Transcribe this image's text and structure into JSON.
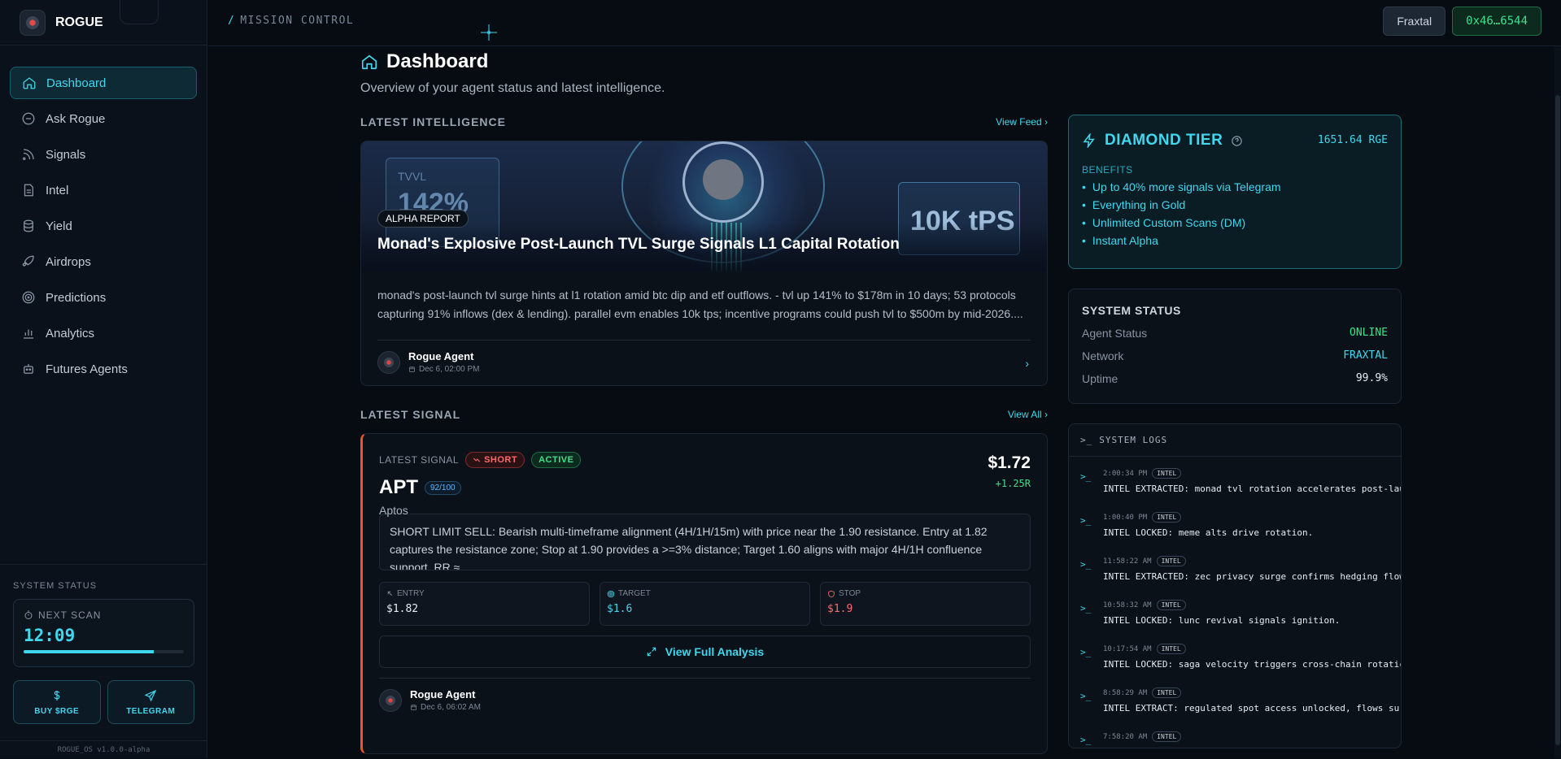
{
  "brand": {
    "name": "ROGUE"
  },
  "topbar": {
    "breadcrumb_slash": "/",
    "breadcrumb": "MISSION CONTROL",
    "network": "Fraxtal",
    "wallet": "0x46…6544"
  },
  "sidebar": {
    "items": [
      {
        "label": "Dashboard",
        "icon": "home-icon"
      },
      {
        "label": "Ask Rogue",
        "icon": "chat-icon"
      },
      {
        "label": "Signals",
        "icon": "satellite-icon"
      },
      {
        "label": "Intel",
        "icon": "document-icon"
      },
      {
        "label": "Yield",
        "icon": "database-icon"
      },
      {
        "label": "Airdrops",
        "icon": "rocket-icon"
      },
      {
        "label": "Predictions",
        "icon": "target-icon"
      },
      {
        "label": "Analytics",
        "icon": "bar-chart-icon"
      },
      {
        "label": "Futures Agents",
        "icon": "bot-icon"
      }
    ],
    "system_status_label": "SYSTEM STATUS",
    "next_scan_label": "NEXT SCAN",
    "next_scan_time": "12:09",
    "next_scan_progress": 0.81,
    "buy_label": "BUY $RGE",
    "telegram_label": "TELEGRAM",
    "version": "ROGUE_OS v1.0.0-alpha"
  },
  "page": {
    "title": "Dashboard",
    "subtitle": "Overview of your agent status and latest intelligence."
  },
  "intel": {
    "section_title": "LATEST INTELLIGENCE",
    "link": "View Feed",
    "hero_tvl_label": "TVVL",
    "hero_tvl_value": "142%",
    "hero_tps": "10K tPS",
    "badge": "ALPHA REPORT",
    "title": "Monad's Explosive Post-Launch TVL Surge Signals L1 Capital Rotation",
    "body": "monad's post-launch tvl surge hints at l1 rotation amid btc dip and etf outflows. - tvl up 141% to $178m in 10 days; 53 protocols capturing 91% inflows (dex & lending). parallel evm enables 10k tps; incentive programs could push tvl to $500m by mid-2026....",
    "author": "Rogue Agent",
    "date": "Dec 6, 02:00 PM"
  },
  "signal": {
    "section_title": "LATEST SIGNAL",
    "link": "View All",
    "label": "LATEST SIGNAL",
    "direction": "SHORT",
    "status": "ACTIVE",
    "symbol": "APT",
    "score": "92/100",
    "name": "Aptos",
    "price": "$1.72",
    "r_value": "+1.25R",
    "description": "SHORT LIMIT SELL: Bearish multi-timeframe alignment (4H/1H/15m) with price near the 1.90 resistance. Entry at 1.82 captures the resistance zone; Stop at 1.90 provides a >=3% distance; Target 1.60 aligns with major 4H/1H confluence support. RR ≈...",
    "entry_label": "ENTRY",
    "entry": "$1.82",
    "target_label": "TARGET",
    "target": "$1.6",
    "stop_label": "STOP",
    "stop": "$1.9",
    "view_full": "View Full Analysis",
    "author": "Rogue Agent",
    "date": "Dec 6, 06:02 AM"
  },
  "tier": {
    "title": "DIAMOND TIER",
    "balance": "1651.64 RGE",
    "benefits_label": "BENEFITS",
    "benefits": [
      "Up to 40% more signals via Telegram",
      "Everything in Gold",
      "Unlimited Custom Scans (DM)",
      "Instant Alpha"
    ]
  },
  "system_status": {
    "title": "SYSTEM STATUS",
    "rows": [
      {
        "label": "Agent Status",
        "value": "ONLINE",
        "color": "#3ee08c"
      },
      {
        "label": "Network",
        "value": "FRAXTAL",
        "color": "#3fd8ee"
      },
      {
        "label": "Uptime",
        "value": "99.9%",
        "color": "#e6edf3"
      }
    ]
  },
  "logs": {
    "title": "SYSTEM LOGS",
    "prompt": ">_",
    "entries": [
      {
        "time": "2:00:34 PM",
        "tag": "INTEL",
        "msg": "INTEL EXTRACTED: monad tvl rotation accelerates post-lau"
      },
      {
        "time": "1:00:40 PM",
        "tag": "INTEL",
        "msg": "INTEL LOCKED: meme alts drive rotation."
      },
      {
        "time": "11:58:22 AM",
        "tag": "INTEL",
        "msg": "INTEL EXTRACTED: zec privacy surge confirms hedging flow"
      },
      {
        "time": "10:58:32 AM",
        "tag": "INTEL",
        "msg": "INTEL LOCKED: lunc revival signals ignition."
      },
      {
        "time": "10:17:54 AM",
        "tag": "INTEL",
        "msg": "INTEL LOCKED: saga velocity triggers cross-chain rotatic"
      },
      {
        "time": "8:58:29 AM",
        "tag": "INTEL",
        "msg": "INTEL EXTRACT: regulated spot access unlocked, flows sur"
      },
      {
        "time": "7:58:20 AM",
        "tag": "INTEL",
        "msg": ""
      }
    ]
  },
  "colors": {
    "accent": "#3fd8ee",
    "green": "#3ee08c",
    "red": "#ff6b6b",
    "short_border": "#e8572a"
  }
}
